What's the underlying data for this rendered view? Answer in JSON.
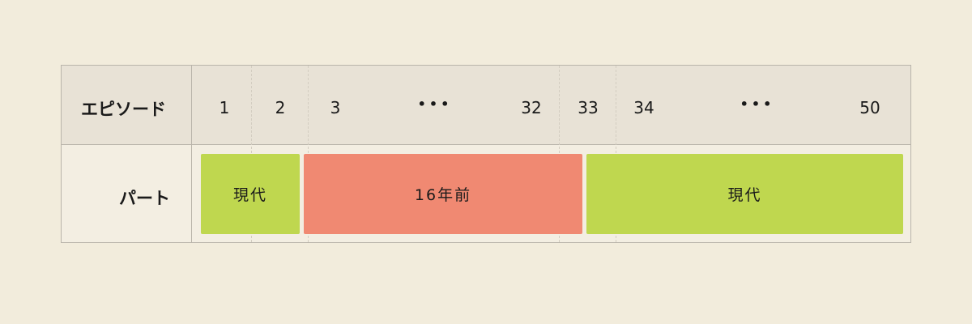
{
  "header": {
    "row_label": "エピソード",
    "episodes": [
      "1",
      "2",
      "3",
      "32",
      "33",
      "34",
      "50"
    ],
    "dots": "•••"
  },
  "part_row": {
    "row_label": "パート",
    "segments": [
      {
        "label": "現代",
        "color": "#bfd74f"
      },
      {
        "label": "16年前",
        "color": "#f08972"
      },
      {
        "label": "現代",
        "color": "#bfd74f"
      }
    ]
  }
}
